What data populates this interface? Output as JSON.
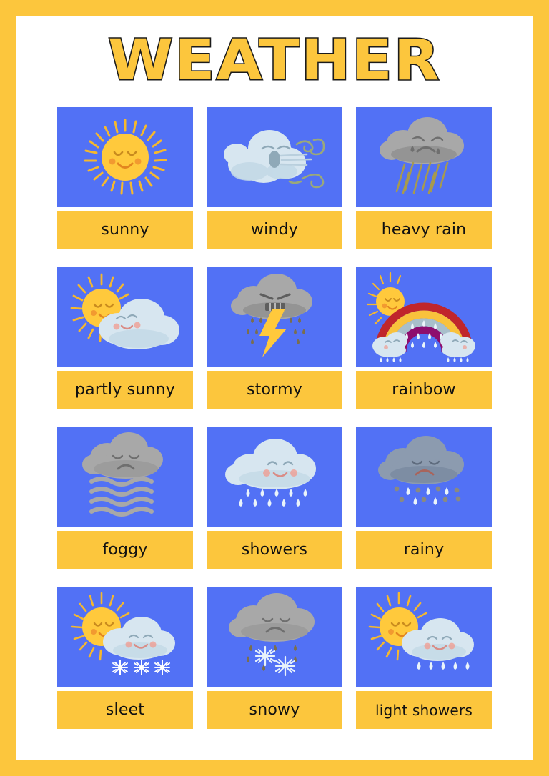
{
  "poster": {
    "title": "WEATHER",
    "border_color": "#FCC63D",
    "sheet_color": "#FFFFFF",
    "title_fill": "#FCC63D",
    "title_outline": "#1B1B1B",
    "image_bg": "#5271F5",
    "label_bg": "#FCC63D",
    "label_text_color": "#111111"
  },
  "palette": {
    "blue_bg": "#5271F5",
    "yellow": "#FCC63D",
    "sun_yellow": "#FFC93C",
    "sun_ray": "#F5B82E",
    "cloud_light": "#D7E6F0",
    "cloud_light_shade": "#C2D8E6",
    "cloud_gray": "#A8A8A8",
    "cloud_gray_shade": "#949494",
    "cloud_bluegray": "#8C9BAF",
    "cloud_bluegray_shade": "#7D8DA3",
    "rain_olive": "#A79A4F",
    "rain_dark": "#7A6E4E",
    "rain_white": "#EAF4FA",
    "snow_white": "#FFFFFF",
    "lightning": "#FFC93C",
    "blush": "#F19A8E",
    "rainbow_red": "#C0262C",
    "rainbow_gold": "#F9C23C",
    "rainbow_blue": "#A8BFCB",
    "rainbow_purple": "#8E0D6E",
    "wind_swirl": "#9AA87A"
  },
  "cards": [
    {
      "id": "sunny",
      "label": "sunny",
      "icon": "sun-icon"
    },
    {
      "id": "windy",
      "label": "windy",
      "icon": "wind-cloud-icon"
    },
    {
      "id": "heavy-rain",
      "label": "heavy rain",
      "icon": "heavy-rain-cloud-icon"
    },
    {
      "id": "partly-sunny",
      "label": "partly sunny",
      "icon": "sun-behind-cloud-icon"
    },
    {
      "id": "stormy",
      "label": "stormy",
      "icon": "thunderstorm-cloud-icon"
    },
    {
      "id": "rainbow",
      "label": "rainbow",
      "icon": "rainbow-icon"
    },
    {
      "id": "foggy",
      "label": "foggy",
      "icon": "fog-cloud-icon"
    },
    {
      "id": "showers",
      "label": "showers",
      "icon": "rain-cloud-icon"
    },
    {
      "id": "rainy",
      "label": "rainy",
      "icon": "rainy-cloud-icon"
    },
    {
      "id": "sleet",
      "label": "sleet",
      "icon": "sun-cloud-snow-icon"
    },
    {
      "id": "snowy",
      "label": "snowy",
      "icon": "snow-cloud-icon"
    },
    {
      "id": "light-showers",
      "label": "light showers",
      "icon": "sun-cloud-rain-icon"
    }
  ]
}
